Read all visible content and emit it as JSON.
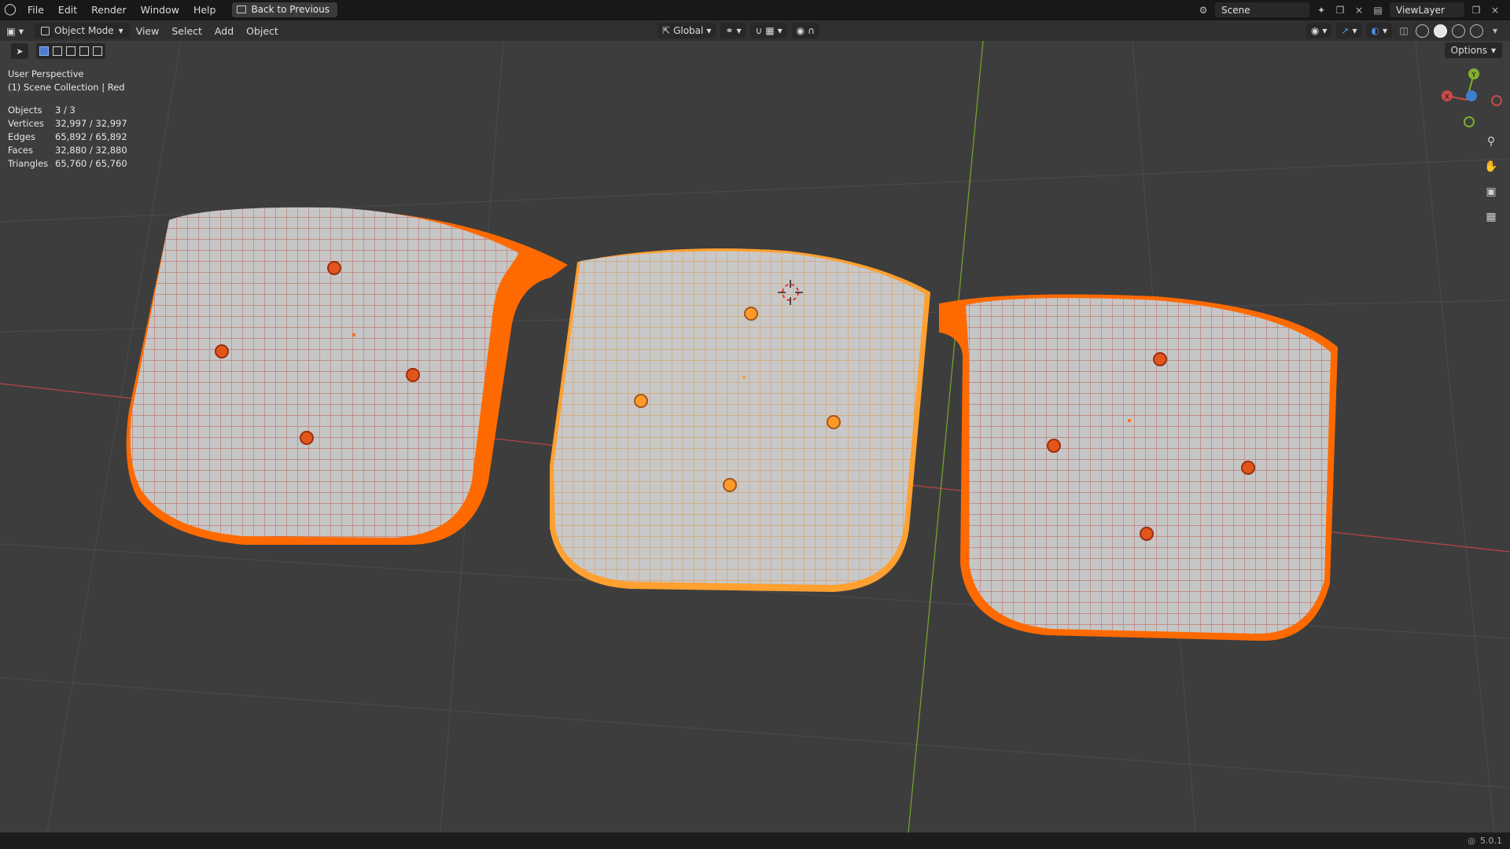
{
  "menubar": {
    "items": [
      "File",
      "Edit",
      "Render",
      "Window",
      "Help"
    ],
    "back_button": "Back to Previous",
    "scene_name": "Scene",
    "view_layer": "ViewLayer"
  },
  "header": {
    "mode": "Object Mode",
    "menus": [
      "View",
      "Select",
      "Add",
      "Object"
    ],
    "transform_orientation": "Global"
  },
  "viewport": {
    "options_label": "Options",
    "perspective": "User Perspective",
    "collection": "(1) Scene Collection | Red",
    "stats": [
      {
        "label": "Objects",
        "value": "3 / 3"
      },
      {
        "label": "Vertices",
        "value": "32,997 / 32,997"
      },
      {
        "label": "Edges",
        "value": "65,892 / 65,892"
      },
      {
        "label": "Faces",
        "value": "32,880 / 32,880"
      },
      {
        "label": "Triangles",
        "value": "65,760 / 65,760"
      }
    ],
    "gizmo": {
      "y": "Y",
      "x": "X"
    }
  },
  "statusbar": {
    "version": "5.0.1"
  },
  "colors": {
    "viewport_bg": "#3d3d3d",
    "selected_orange": "#ff6a00",
    "active_orange": "#ffa030",
    "mesh_surface": "#c8c8c8",
    "axis_x": "#c94a4a",
    "axis_y": "#7fb030"
  },
  "icons": [
    "blender-logo-icon",
    "editor-type-icon",
    "zoom-icon",
    "hand-pan-icon",
    "camera-icon",
    "grid-icon",
    "globe-icon"
  ]
}
